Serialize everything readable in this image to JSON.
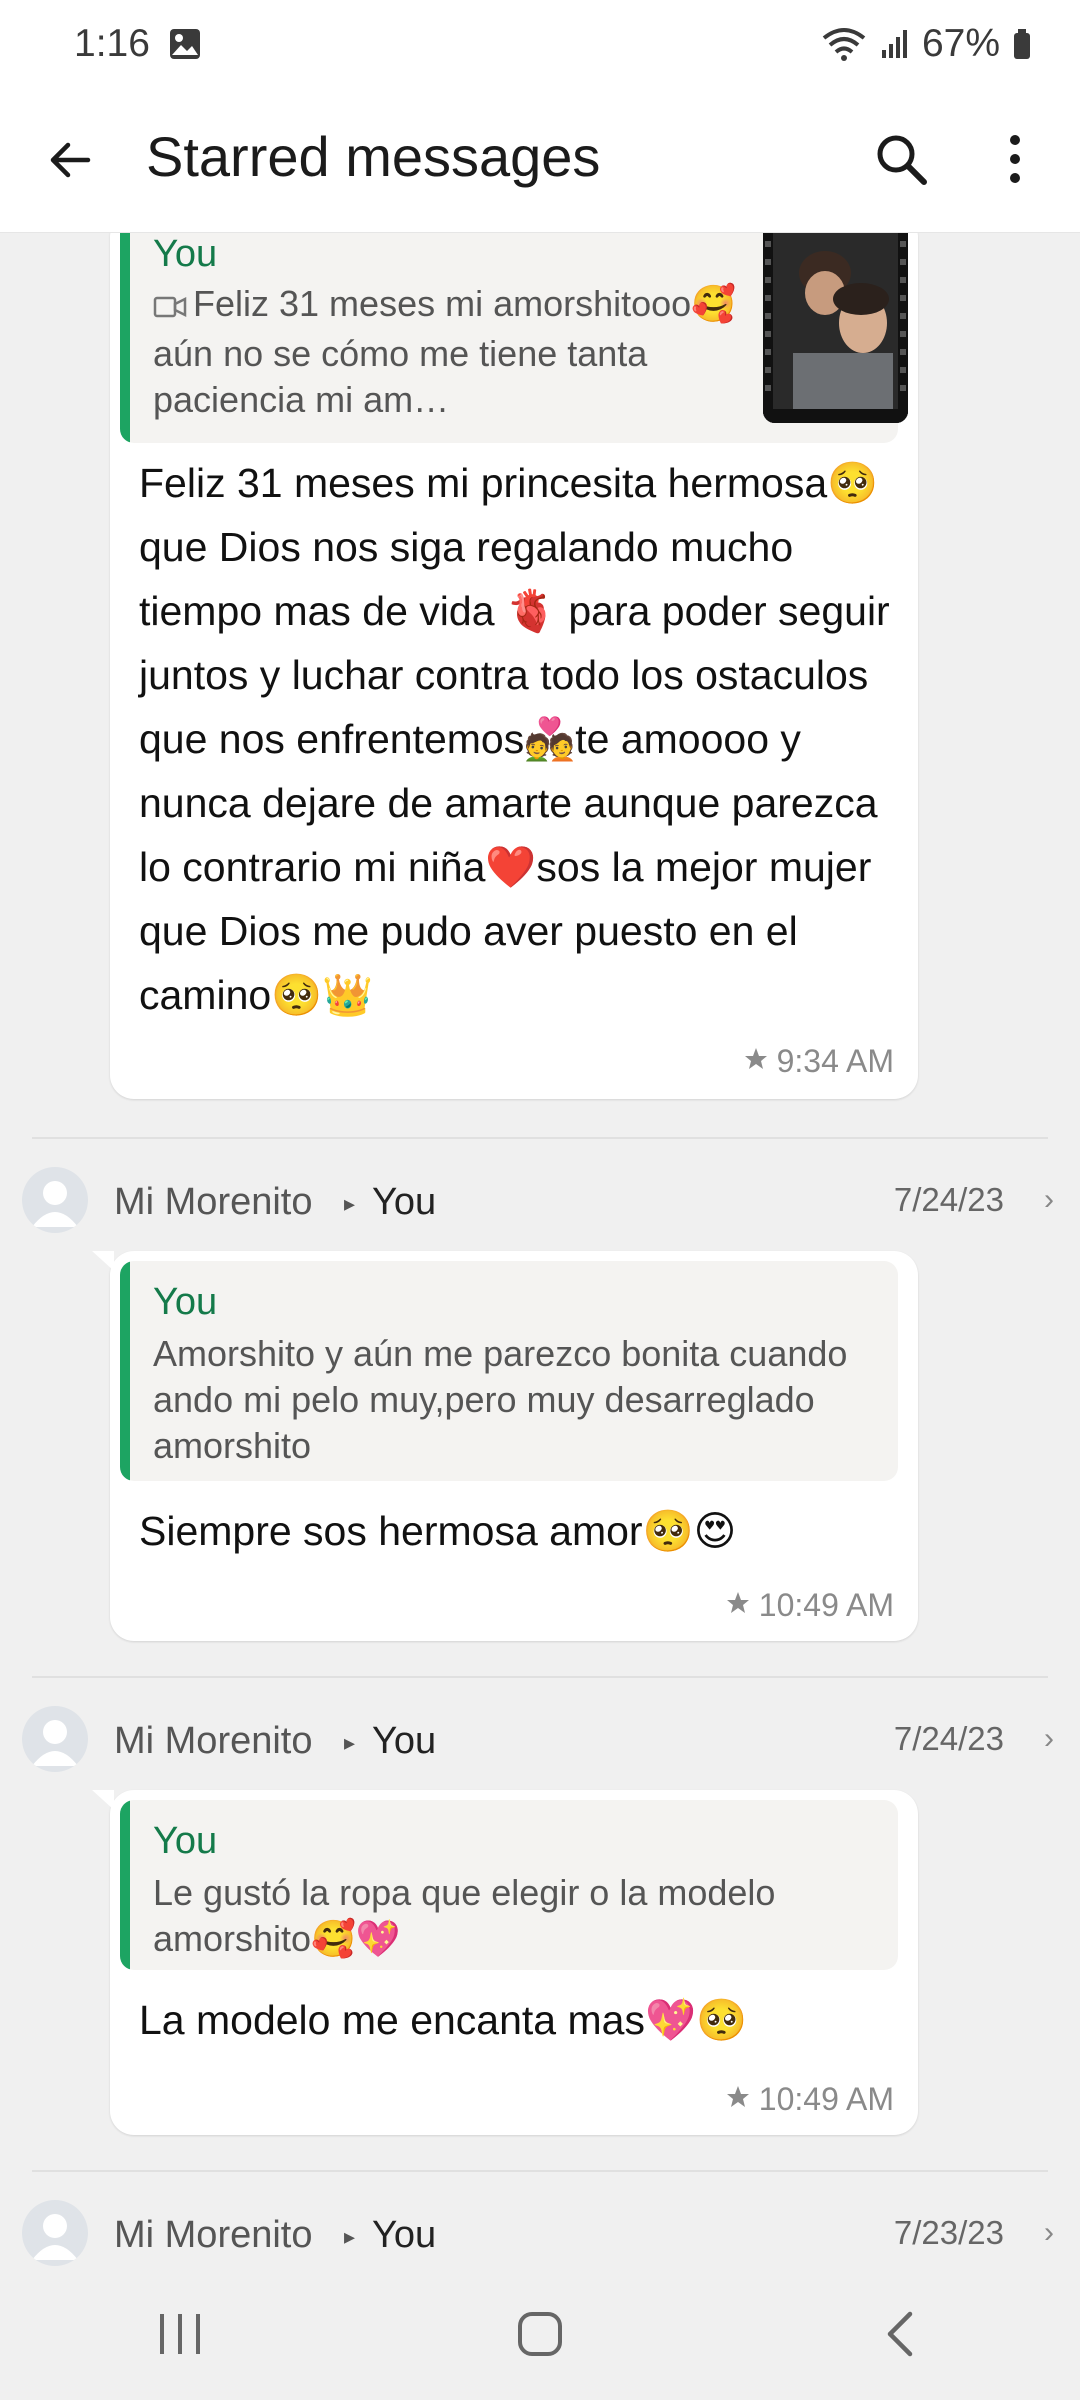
{
  "status_bar": {
    "time": "1:16",
    "battery": "67%",
    "icons": [
      "image-icon",
      "wifi-icon",
      "signal-icon",
      "battery-icon"
    ]
  },
  "app_bar": {
    "title": "Starred messages",
    "icons": [
      "back-arrow-icon",
      "search-icon",
      "more-vert-icon"
    ]
  },
  "colors": {
    "accent_green": "#1da462",
    "quote_author": "#147a4a",
    "bubble": "#ffffff",
    "background": "#f0f0f0"
  },
  "messages": [
    {
      "quote_author": "You",
      "quote_text": "Feliz 31 meses mi amorshitooo🥰aún no se cómo me tiene tanta paciencia mi am…",
      "quote_icon": "video-icon",
      "text": "Feliz 31 meses mi princesita hermosa🥺que Dios nos siga regalando mucho tiempo mas de vida 🫀 para poder seguir juntos y luchar contra todo los ostaculos que nos enfrentemos💑te amoooo y nunca dejare de amarte aunque parezca lo contrario mi niña❤️sos la mejor mujer que Dios me pudo aver puesto en el camino🥺👑",
      "time": "9:34 AM"
    },
    {
      "sender": "Mi Morenito",
      "recipient": "You",
      "date": "7/24/23",
      "quote_author": "You",
      "quote_text": "Amorshito y aún me parezco bonita cuando ando mi pelo muy,pero muy desarreglado amorshito",
      "text": "Siempre sos hermosa amor🥺😍",
      "time": "10:49 AM"
    },
    {
      "sender": "Mi Morenito",
      "recipient": "You",
      "date": "7/24/23",
      "quote_author": "You",
      "quote_text": "Le gustó la ropa que elegir o la modelo amorshito🥰💖",
      "text": "La modelo me encanta mas💖🥺",
      "time": "10:49 AM"
    },
    {
      "sender": "Mi Morenito",
      "recipient": "You",
      "date": "7/23/23"
    }
  ],
  "nav_bar": {
    "icons": [
      "recents-icon",
      "home-icon",
      "back-icon"
    ]
  }
}
